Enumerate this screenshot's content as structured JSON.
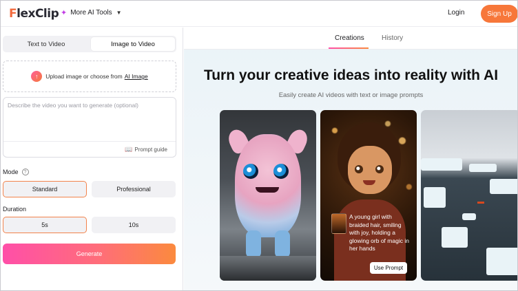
{
  "header": {
    "logo_text_f": "F",
    "logo_text_rest": "lexClip",
    "ai_tools_label": "More AI Tools",
    "login_label": "Login",
    "signup_label": "Sign Up"
  },
  "left": {
    "tabs": [
      {
        "label": "Text to Video",
        "active": false
      },
      {
        "label": "Image to Video",
        "active": true
      }
    ],
    "upload": {
      "text": "Upload image or choose from",
      "link": "AI Image"
    },
    "prompt": {
      "placeholder": "Describe the video you want to generate (optional)",
      "value": "",
      "guide_label": "Prompt guide"
    },
    "mode": {
      "label": "Mode",
      "help": "?",
      "options": [
        {
          "label": "Standard",
          "selected": true
        },
        {
          "label": "Professional",
          "selected": false
        }
      ]
    },
    "duration": {
      "label": "Duration",
      "options": [
        {
          "label": "5s",
          "selected": true
        },
        {
          "label": "10s",
          "selected": false
        }
      ]
    },
    "generate_label": "Generate"
  },
  "right": {
    "tabs": [
      {
        "label": "Creations",
        "active": true
      },
      {
        "label": "History",
        "active": false
      }
    ],
    "hero_title": "Turn your creative ideas into reality with AI",
    "hero_subtitle": "Easily create AI videos with text or image prompts",
    "cards": [
      {
        "subject": "pink fluffy creature in snow"
      },
      {
        "subject": "young girl with glowing orb",
        "caption": "A young girl with braided hair, smiling with joy, holding a glowing orb of magic in her hands",
        "button": "Use Prompt"
      },
      {
        "subject": "icebergs in dark water"
      }
    ]
  },
  "colors": {
    "accent_orange": "#f7773a",
    "gradient_start": "#ff4fa8",
    "gradient_end": "#fb8a3e"
  }
}
